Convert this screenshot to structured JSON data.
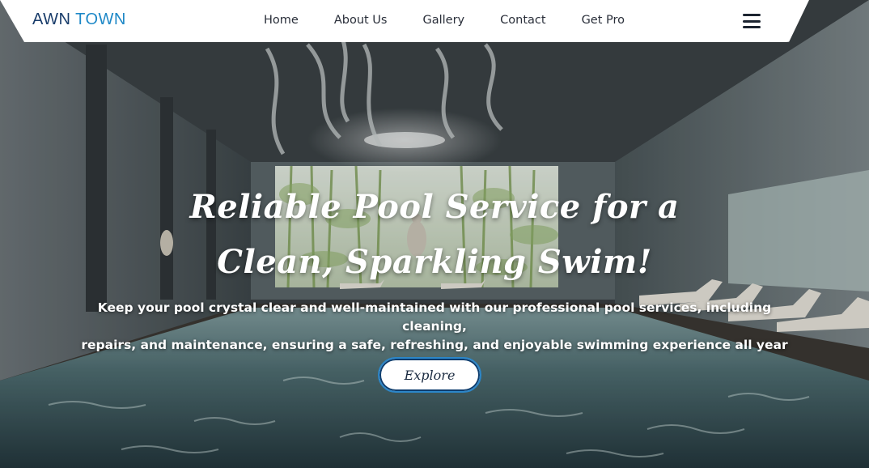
{
  "nav": {
    "brand_part1": "AWN",
    "brand_part2": "TOWN",
    "links": [
      "Home",
      "About Us",
      "Gallery",
      "Contact",
      "Get Pro"
    ],
    "menu_icon": "hamburger-menu-icon"
  },
  "hero": {
    "headline_line1": "Reliable Pool Service for a",
    "headline_line2": "Clean, Sparkling Swim!",
    "subtext_line1": "Keep your pool crystal clear and well-maintained with our professional pool services, including cleaning,",
    "subtext_line2": "repairs, and maintenance, ensuring a safe, refreshing, and enjoyable swimming experience all year round.",
    "cta_label": "Explore"
  },
  "colors": {
    "brand_dark": "#1a3d6b",
    "brand_accent": "#1e88c7",
    "button_border": "#2c86c8"
  }
}
